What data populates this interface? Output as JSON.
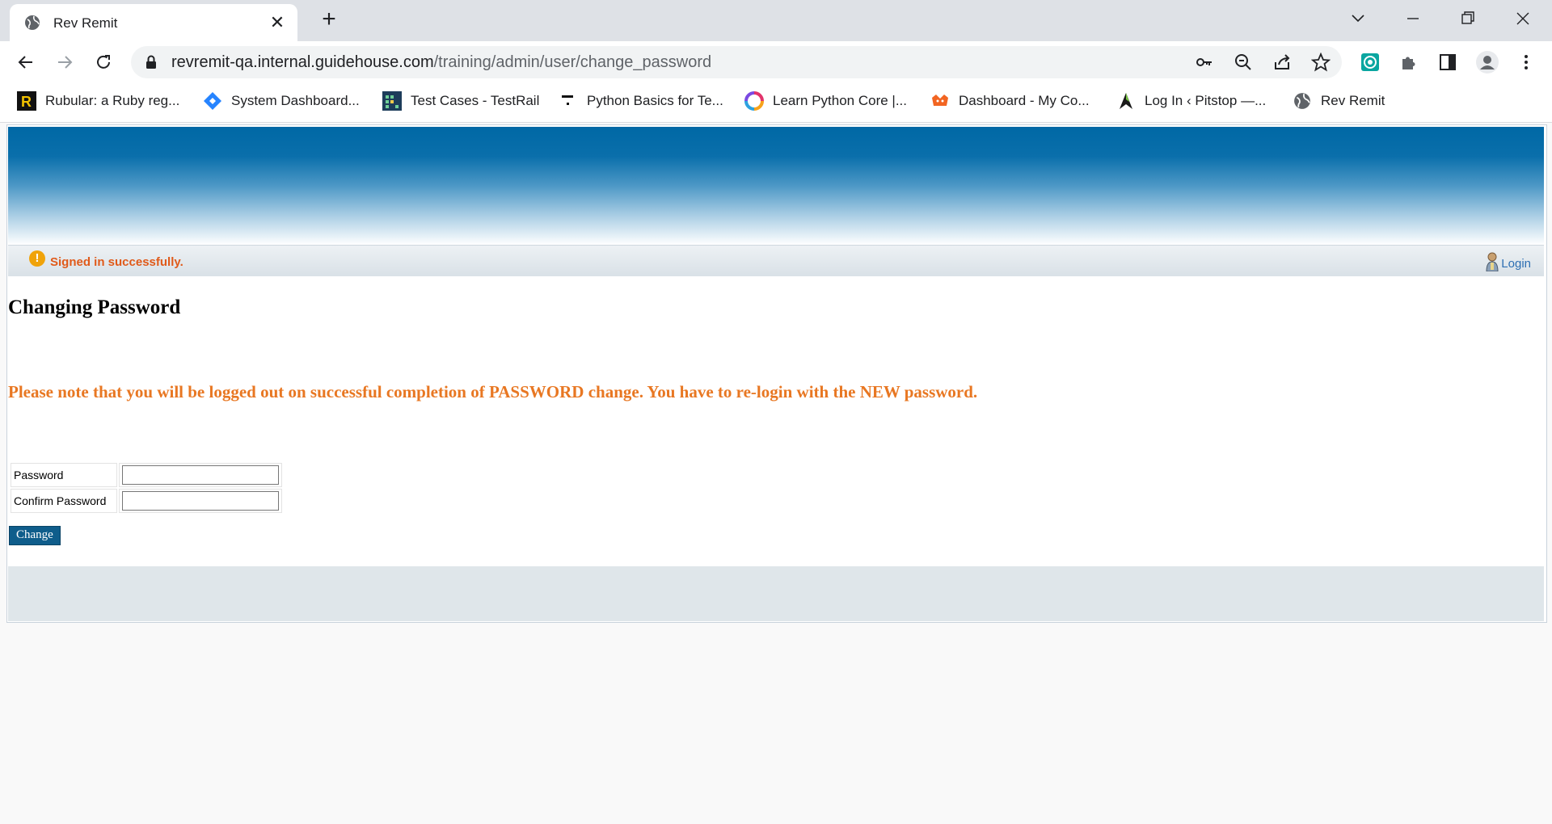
{
  "browser": {
    "tab_title": "Rev Remit",
    "url_host": "revremit-qa.internal.guidehouse.com",
    "url_path": "/training/admin/user/change_password",
    "bookmarks": [
      {
        "label": "Rubular: a Ruby reg...",
        "icon": "rubular-icon"
      },
      {
        "label": "System Dashboard...",
        "icon": "jira-diamond-icon"
      },
      {
        "label": "Test Cases - TestRail",
        "icon": "testrail-icon"
      },
      {
        "label": "Python Basics for Te...",
        "icon": "python-basics-icon"
      },
      {
        "label": "Learn Python Core |...",
        "icon": "swirl-icon"
      },
      {
        "label": "Dashboard - My Co...",
        "icon": "dashboard-icon"
      },
      {
        "label": "Log In ‹ Pitstop —...",
        "icon": "pitstop-icon"
      },
      {
        "label": "Rev Remit",
        "icon": "globe-icon"
      }
    ]
  },
  "status": {
    "message": "Signed in successfully.",
    "login_label": "Login",
    "icon": "warning-icon"
  },
  "main": {
    "title": "Changing Password",
    "notice": "Please note that you will be logged out on successful completion of PASSWORD change. You have to re-login with the NEW password.",
    "fields": [
      {
        "label": "Password",
        "value": ""
      },
      {
        "label": "Confirm Password",
        "value": ""
      }
    ],
    "submit_label": "Change"
  },
  "colors": {
    "notice": "#e87722",
    "status_message": "#e05a1a",
    "banner_top": "#0068a5",
    "button": "#0f5d8b"
  }
}
